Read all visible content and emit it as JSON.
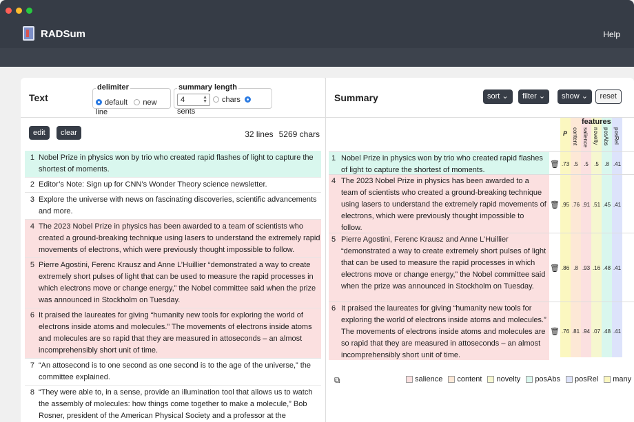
{
  "app": {
    "title": "RADSum",
    "help": "Help",
    "dots": [
      "#ff5f57",
      "#febc2e",
      "#28c840"
    ]
  },
  "left": {
    "title": "Text",
    "delimiter_label": "delimiter",
    "delimiter_options": [
      "default",
      "new line"
    ],
    "summary_length_label": "summary length",
    "summary_length_value": "4",
    "unit_options": [
      "chars",
      "sents"
    ],
    "edit": "edit",
    "clear": "clear",
    "lines_count": "32 lines",
    "chars_count": "5269 chars",
    "lines": [
      {
        "n": "1",
        "text": "Nobel Prize in physics won by trio who created rapid flashes of light to capture the shortest of moments.",
        "hl": "green"
      },
      {
        "n": "2",
        "text": "Editor’s Note: Sign up for CNN’s Wonder Theory science newsletter.",
        "hl": ""
      },
      {
        "n": "3",
        "text": "Explore the universe with news on fascinating discoveries, scientific advancements and more.",
        "hl": ""
      },
      {
        "n": "4",
        "text": "The 2023 Nobel Prize in physics has been awarded to a team of scientists who created a ground-breaking technique using lasers to understand the extremely rapid movements of electrons, which were previously thought impossible to follow.",
        "hl": "pink"
      },
      {
        "n": "5",
        "text": "Pierre Agostini, Ferenc Krausz and Anne L’Huillier “demonstrated a way to create extremely short pulses of light that can be used to measure the rapid processes in which electrons move or change energy,” the Nobel committee said when the prize was announced in Stockholm on Tuesday.",
        "hl": "pink"
      },
      {
        "n": "6",
        "text": "It praised the laureates for giving “humanity new tools for exploring the world of electrons inside atoms and molecules.” The movements of electrons inside atoms and molecules are so rapid that they are measured in attoseconds – an almost incomprehensibly short unit of time.",
        "hl": "pink"
      },
      {
        "n": "7",
        "text": "“An attosecond is to one second as one second is to the age of the universe,” the committee explained.",
        "hl": ""
      },
      {
        "n": "8",
        "text": "“They were able to, in a sense, provide an illumination tool that allows us to watch the assembly of molecules: how things come together to make a molecule,” Bob Rosner, president of the American Physical Society and a professor at the University of Chicago, told CNN.",
        "hl": ""
      }
    ]
  },
  "right": {
    "title": "Summary",
    "buttons": [
      "sort",
      "filter",
      "show"
    ],
    "reset": "reset",
    "features_label": "features",
    "p_label": "P",
    "feature_cols": [
      "content",
      "salience",
      "novelty",
      "posAbs",
      "posRel"
    ],
    "rows": [
      {
        "n": "1",
        "text": "Nobel Prize in physics won by trio who created rapid flashes of light to capture the shortest of moments.",
        "hl": "green",
        "vals": [
          ".73",
          ".5",
          ".5",
          ".5",
          ".8",
          ".41"
        ]
      },
      {
        "n": "4",
        "text": "The 2023 Nobel Prize in physics has been awarded to a team of scientists who created a ground-breaking technique using lasers to understand the extremely rapid movements of electrons, which were previously thought impossible to follow.",
        "hl": "pink",
        "vals": [
          ".95",
          ".76",
          ".91",
          ".51",
          ".45",
          ".41"
        ]
      },
      {
        "n": "5",
        "text": "Pierre Agostini, Ferenc Krausz and Anne L’Huillier “demonstrated a way to create extremely short pulses of light that can be used to measure the rapid processes in which electrons move or change energy,” the Nobel committee said when the prize was announced in Stockholm on Tuesday.",
        "hl": "pink",
        "vals": [
          ".86",
          ".8",
          ".93",
          ".16",
          ".48",
          ".41"
        ]
      },
      {
        "n": "6",
        "text": "It praised the laureates for giving “humanity new tools for exploring the world of electrons inside atoms and molecules.” The movements of electrons inside atoms and molecules are so rapid that they are measured in attoseconds – an almost incomprehensibly short unit of time.",
        "hl": "pink",
        "vals": [
          ".76",
          ".81",
          ".94",
          ".07",
          ".48",
          ".41"
        ]
      }
    ],
    "legend": [
      {
        "label": "salience",
        "color": "#fbe0e0"
      },
      {
        "label": "content",
        "color": "#fde8d6"
      },
      {
        "label": "novelty",
        "color": "#f6f7cf"
      },
      {
        "label": "posAbs",
        "color": "#d9f7ee"
      },
      {
        "label": "posRel",
        "color": "#dde3fb"
      },
      {
        "label": "many",
        "color": "#fbf7c0"
      }
    ]
  }
}
